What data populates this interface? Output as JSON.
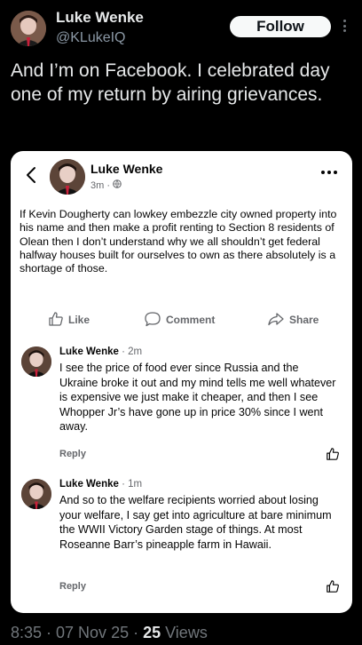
{
  "tweet": {
    "author_name": "Luke Wenke",
    "author_handle": "@KLukeIQ",
    "follow_label": "Follow",
    "text": "And I’m on Facebook.  I celebrated day one of my return by airing grievances.",
    "timestamp": "8:35 · 07 Nov 25 · ",
    "views_count": "25",
    "views_label": " Views"
  },
  "facebook_post": {
    "author_name": "Luke Wenke",
    "time": "3m ·",
    "text": "If Kevin Dougherty can lowkey embezzle city owned property into his name and then make a profit renting to Section 8 residents of Olean then I don’t understand why we all shouldn’t get federal halfway houses built for ourselves to own as there absolutely is a shortage of those.",
    "actions": {
      "like": "Like",
      "comment": "Comment",
      "share": "Share"
    },
    "comments": [
      {
        "author": "Luke Wenke",
        "time": " · 2m",
        "text": "I see the price of food ever since Russia and the Ukraine broke it out and my mind tells me well whatever is expensive we just make it cheaper, and then I see Whopper Jr’s have gone up in price 30% since I went away.",
        "reply": "Reply"
      },
      {
        "author": "Luke Wenke",
        "time": " · 1m",
        "text": "And so to the welfare recipients worried about losing your welfare, I say get into agriculture at bare minimum the WWII Victory Garden stage of things.  At most Roseanne Barr’s pineapple farm in Hawaii.",
        "reply": "Reply"
      }
    ]
  },
  "colors": {
    "background": "#000000",
    "card": "#ffffff",
    "secondary_text": "#71767b",
    "fb_gray": "#65676b"
  },
  "icons": [
    "three-dots-icon",
    "back-chevron-icon",
    "globe-icon",
    "thumbs-up-icon",
    "speech-bubble-icon",
    "share-arrow-icon"
  ]
}
